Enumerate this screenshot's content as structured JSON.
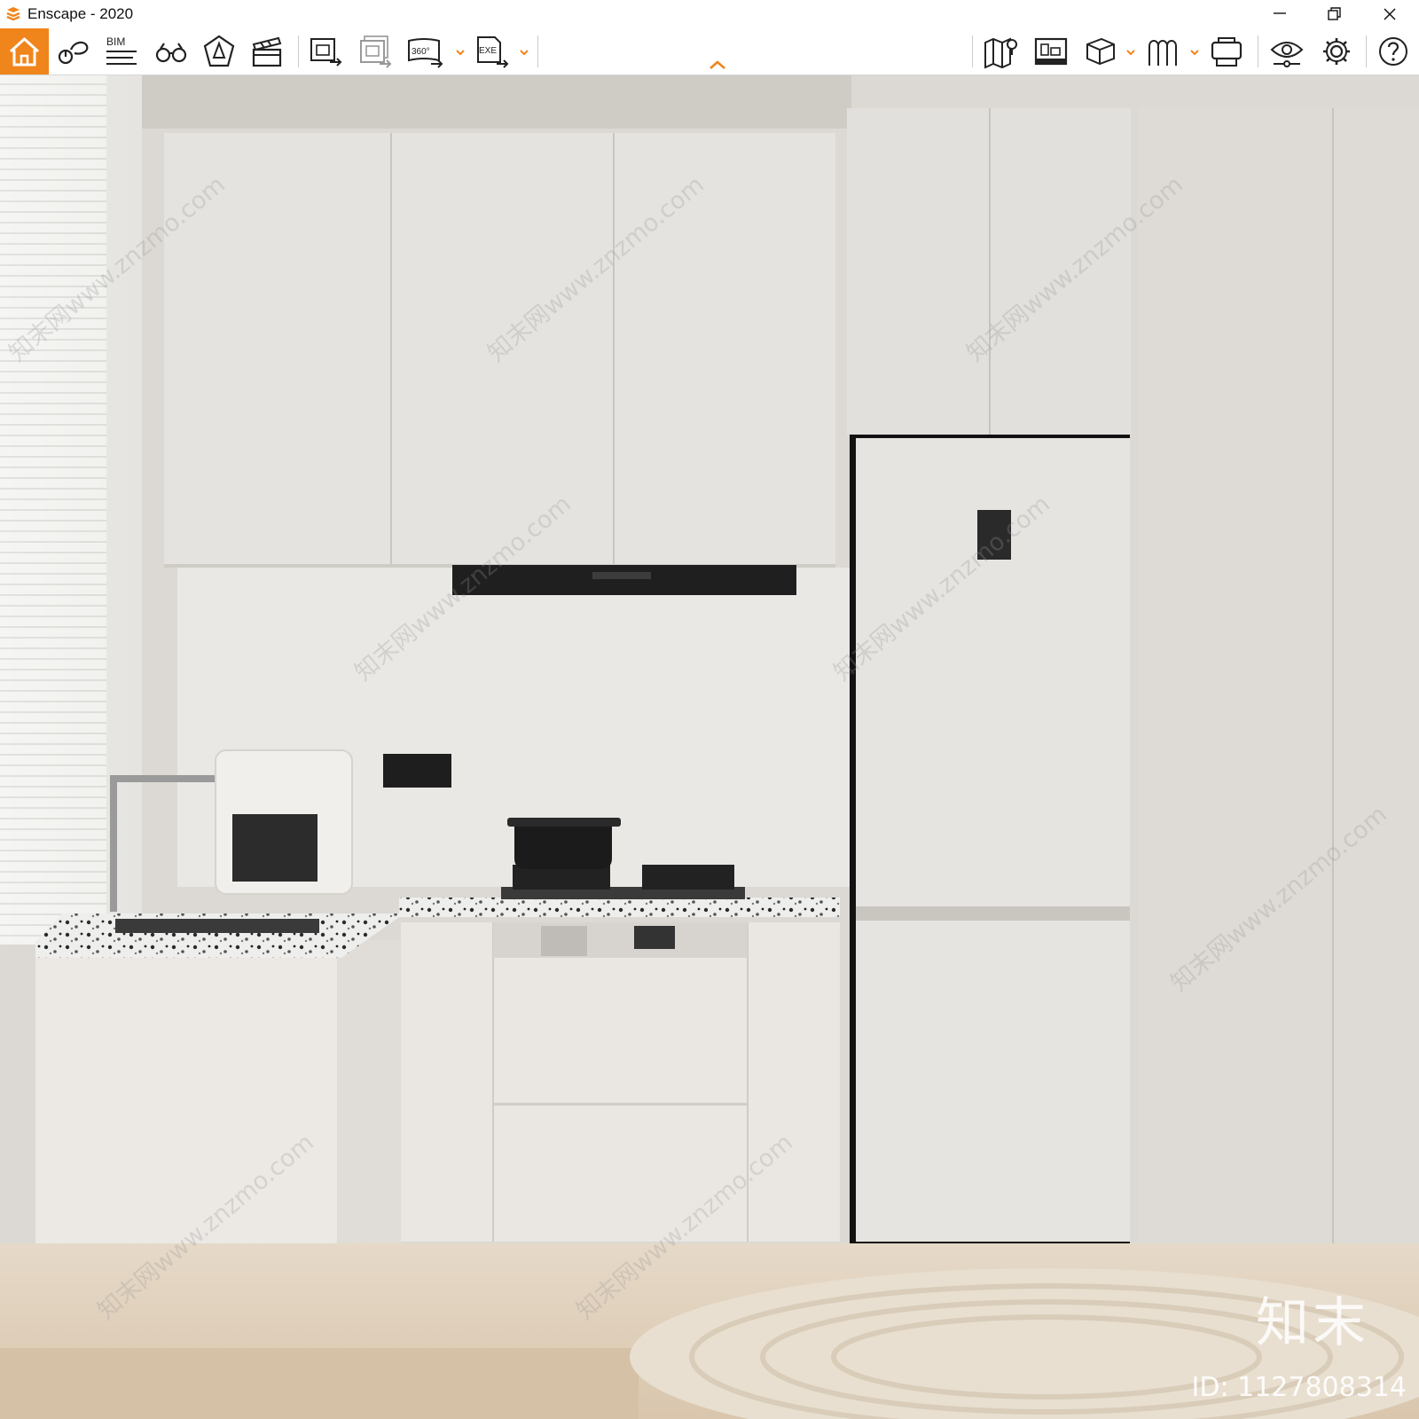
{
  "window": {
    "title": "Enscape - 2020",
    "accent_color": "#f0851c"
  },
  "toolbar": {
    "bim_label": "BIM",
    "video_360_label": "360°",
    "exe_label": "EXE",
    "icons": [
      "home-icon",
      "asset-library-icon",
      "bim-info-icon",
      "binoculars-icon",
      "views-icon",
      "video-editor-icon",
      "screenshot-export-icon",
      "batch-render-icon",
      "panorama-export-icon",
      "exe-export-icon",
      "minimap-icon",
      "live-updates-icon",
      "cube-icon",
      "tree-asset-icon",
      "vr-headset-icon",
      "visual-settings-icon",
      "settings-icon",
      "help-icon"
    ]
  },
  "viewport": {
    "watermark_text": "知末网www.znzmo.com",
    "brand_mark": "知末",
    "image_id": "ID: 1127808314"
  }
}
